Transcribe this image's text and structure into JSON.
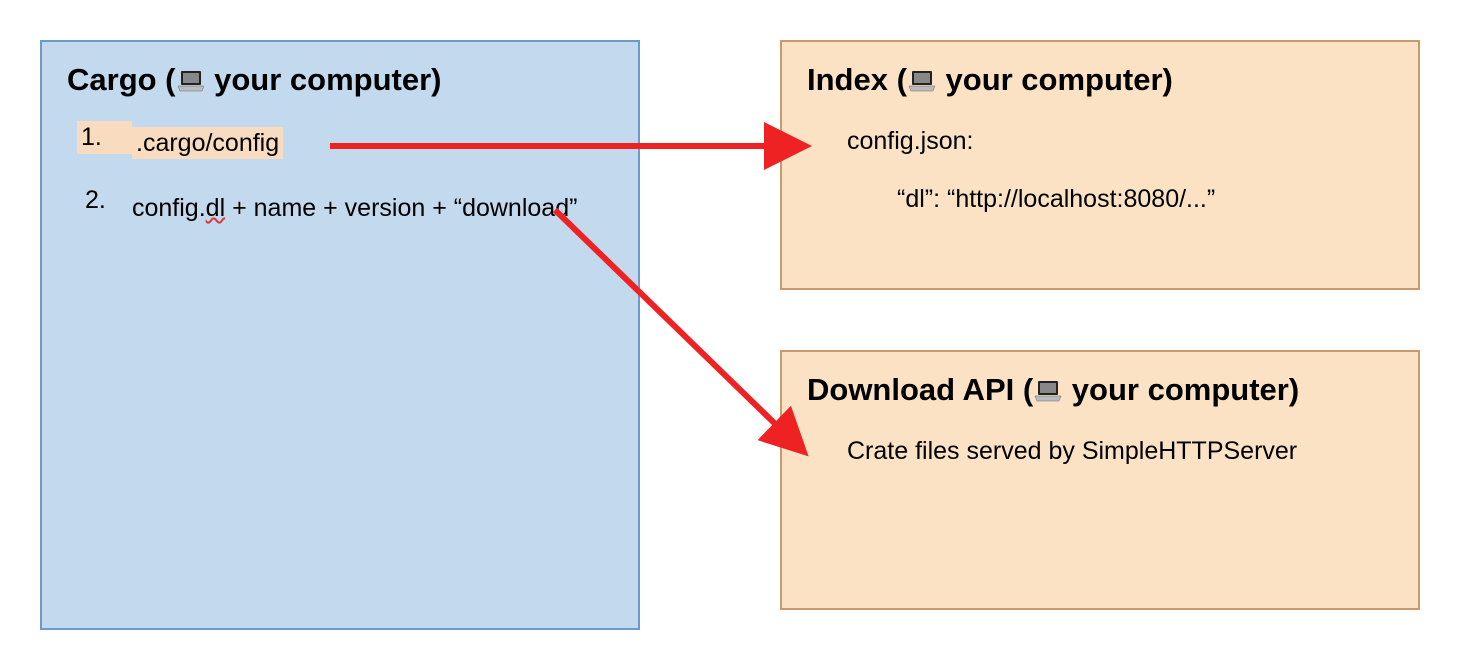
{
  "cargo": {
    "title_prefix": "Cargo (",
    "title_suffix": " your computer)",
    "items": [
      {
        "number": "1.",
        "text": ".cargo/config",
        "highlighted": true
      },
      {
        "number": "2.",
        "text_pre": "config.",
        "text_spell": "dl",
        "text_post": " + name + version + “download”"
      }
    ]
  },
  "index": {
    "title_prefix": "Index (",
    "title_suffix": " your computer)",
    "line1": "config.json:",
    "line2": "“dl”: “http://localhost:8080/...”"
  },
  "download": {
    "title_prefix": "Download API (",
    "title_suffix": " your computer)",
    "line1": "Crate files served by SimpleHTTPServer"
  },
  "arrows": {
    "color": "#ee2222"
  }
}
